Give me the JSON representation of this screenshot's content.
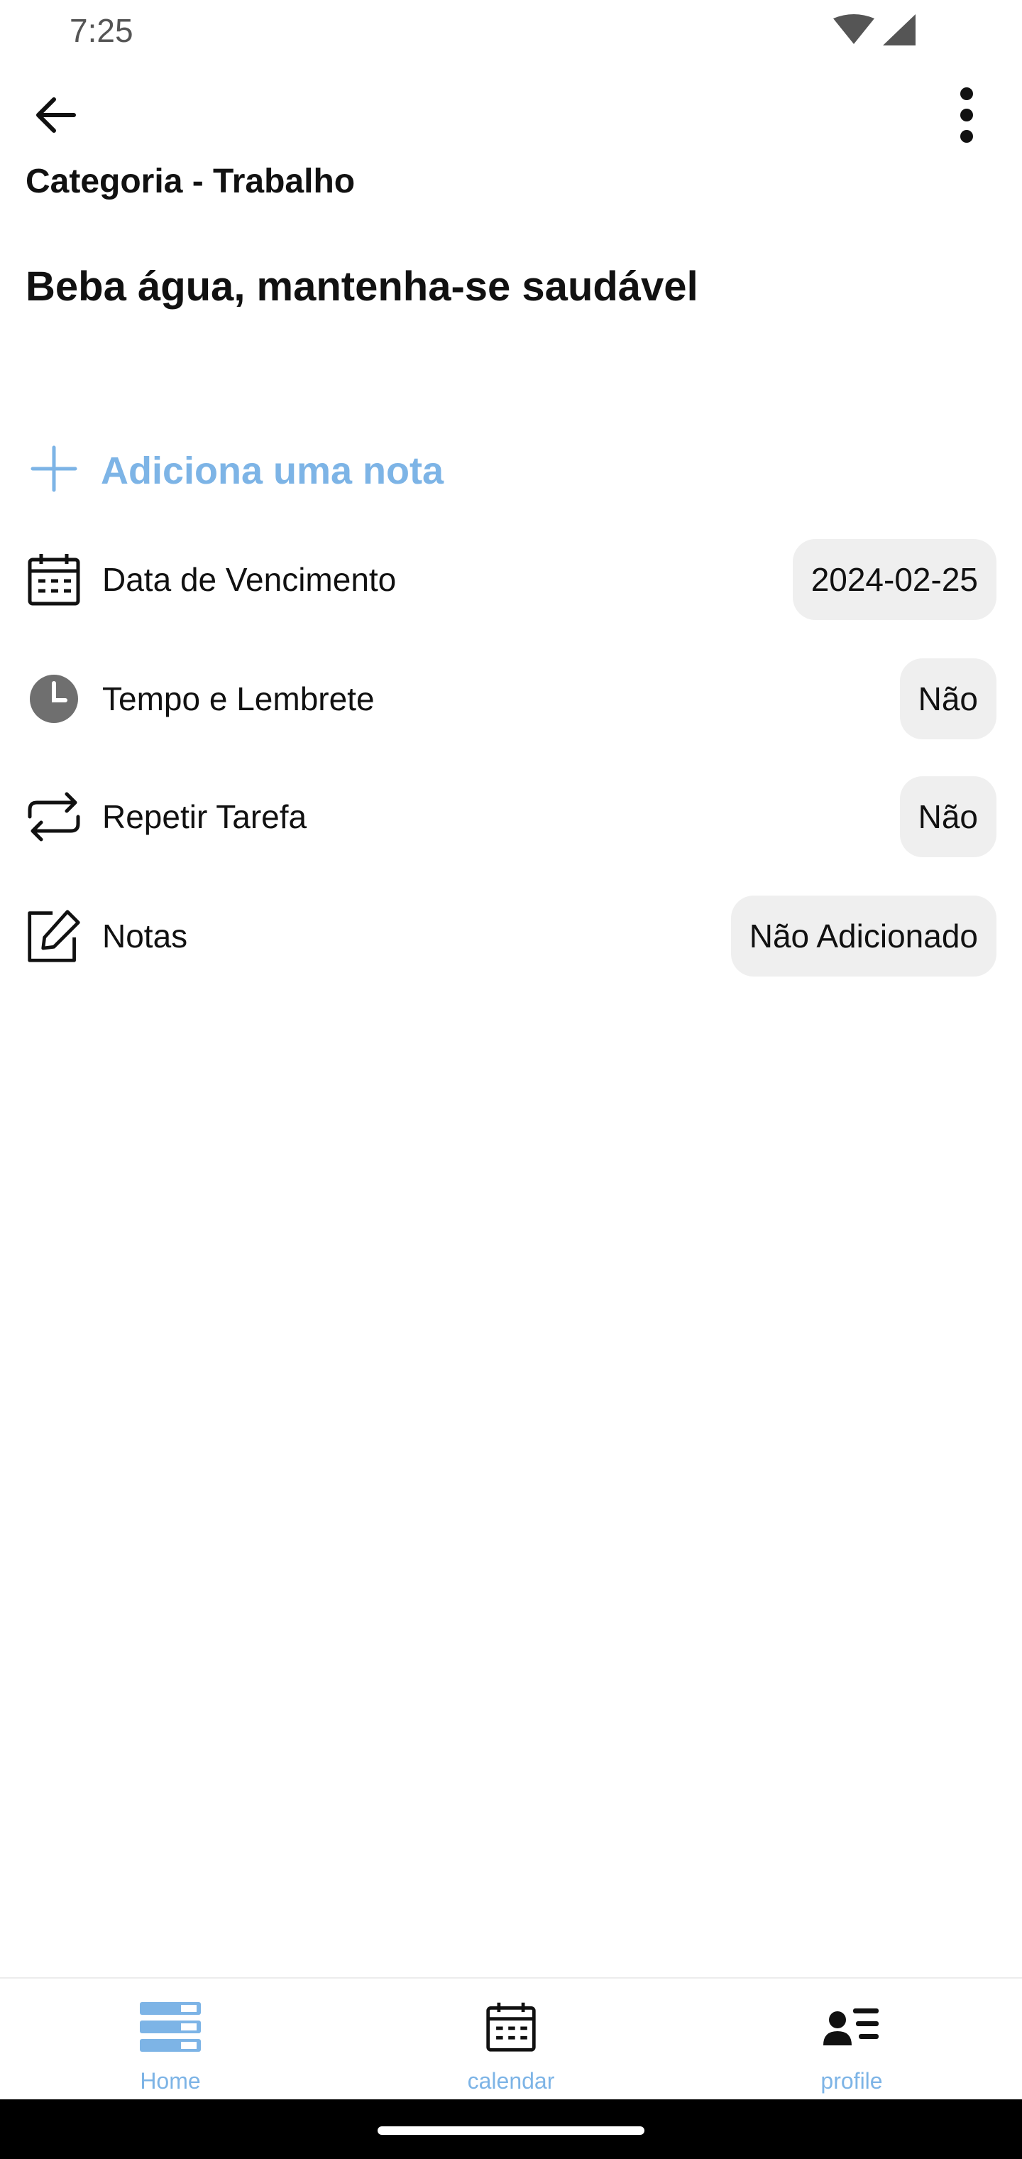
{
  "status_bar": {
    "time": "7:25"
  },
  "header": {
    "category": "Categoria - Trabalho"
  },
  "task": {
    "title": "Beba água, mantenha-se saudável"
  },
  "add_note": {
    "label": "Adiciona uma nota"
  },
  "details": [
    {
      "label": "Data de Vencimento",
      "value": "2024-02-25",
      "icon": "calendar-icon"
    },
    {
      "label": "Tempo e Lembrete",
      "value": "Não",
      "icon": "clock-icon"
    },
    {
      "label": "Repetir Tarefa",
      "value": "Não",
      "icon": "repeat-icon"
    },
    {
      "label": "Notas",
      "value": "Não Adicionado",
      "icon": "edit-note-icon"
    }
  ],
  "bottom_nav": [
    {
      "label": "Home",
      "icon": "home-list-icon"
    },
    {
      "label": "calendar",
      "icon": "calendar-icon"
    },
    {
      "label": "profile",
      "icon": "profile-list-icon"
    }
  ],
  "colors": {
    "accent": "#7db4e6",
    "chip_bg": "#efefef"
  }
}
